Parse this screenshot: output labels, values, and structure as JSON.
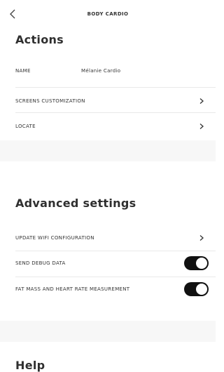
{
  "header": {
    "title": "BODY CARDIO",
    "back_icon": "chevron-left-icon"
  },
  "actions": {
    "title": "Actions",
    "name_label": "NAME",
    "name_value": "Mélanie Cardio",
    "screens_label": "SCREENS CUSTOMIZATION",
    "locate_label": "LOCATE"
  },
  "advanced": {
    "title": "Advanced settings",
    "wifi_label": "UPDATE WIFI CONFIGURATION",
    "debug_label": "SEND DEBUG DATA",
    "debug_on": true,
    "fatmass_label": "FAT MASS AND HEART RATE MEASUREMENT",
    "fatmass_on": true
  },
  "help": {
    "title": "Help"
  },
  "colors": {
    "section_gap": "#f7f7f7",
    "toggle_on": "#111111",
    "divider": "#e9e9e9"
  }
}
